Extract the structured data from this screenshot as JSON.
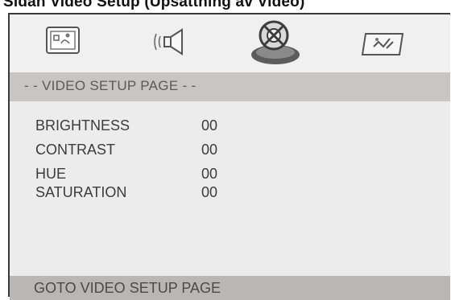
{
  "page_heading": "Sidan Video Setup (Upsättning av Video)",
  "icons": [
    {
      "name": "general-setup-icon",
      "selected": false
    },
    {
      "name": "audio-setup-icon",
      "selected": false
    },
    {
      "name": "video-setup-icon",
      "selected": true
    },
    {
      "name": "preference-setup-icon",
      "selected": false
    }
  ],
  "section_title": "- - VIDEO SETUP PAGE - -",
  "settings": [
    {
      "label": "BRIGHTNESS",
      "value": "00"
    },
    {
      "label": "CONTRAST",
      "value": "00"
    },
    {
      "label": "HUE",
      "value": "00"
    },
    {
      "label": "SATURATION",
      "value": "00"
    }
  ],
  "footer_hint": "GOTO VIDEO SETUP PAGE",
  "colors": {
    "frame_border": "#3a3a3a",
    "menu_background": "#ececec",
    "banner": "#c8c6c4",
    "footer": "#b9b7b5",
    "text": "#3c3c3c"
  }
}
